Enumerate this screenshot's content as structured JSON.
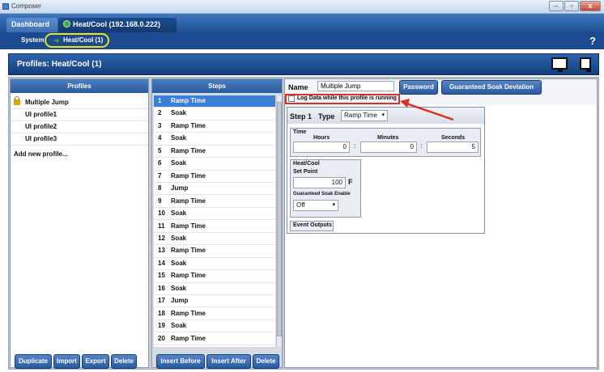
{
  "window": {
    "title": "Composer",
    "minimize": "–",
    "restore": "▫",
    "close": "x"
  },
  "tabs": [
    {
      "label": "Dashboard"
    },
    {
      "label": "Heat/Cool (192.168.0.222)"
    }
  ],
  "breadcrumb": [
    {
      "label": "System"
    },
    {
      "label": "Heat/Cool (1)"
    }
  ],
  "help_label": "?",
  "header": {
    "title": "Profiles: Heat/Cool (1)"
  },
  "profiles": {
    "heading": "Profiles",
    "items": [
      "Multiple Jump",
      "UI profile1",
      "UI profile2",
      "UI profile3"
    ],
    "add_label": "Add new profile...",
    "buttons": [
      "Duplicate",
      "Import",
      "Export",
      "Delete"
    ]
  },
  "steps": {
    "heading": "Steps",
    "items": [
      {
        "num": "1",
        "name": "Ramp Time"
      },
      {
        "num": "2",
        "name": "Soak"
      },
      {
        "num": "3",
        "name": "Ramp Time"
      },
      {
        "num": "4",
        "name": "Soak"
      },
      {
        "num": "5",
        "name": "Ramp Time"
      },
      {
        "num": "6",
        "name": "Soak"
      },
      {
        "num": "7",
        "name": "Ramp Time"
      },
      {
        "num": "8",
        "name": "Jump"
      },
      {
        "num": "9",
        "name": "Ramp Time"
      },
      {
        "num": "10",
        "name": "Soak"
      },
      {
        "num": "11",
        "name": "Ramp Time"
      },
      {
        "num": "12",
        "name": "Soak"
      },
      {
        "num": "13",
        "name": "Ramp Time"
      },
      {
        "num": "14",
        "name": "Soak"
      },
      {
        "num": "15",
        "name": "Ramp Time"
      },
      {
        "num": "16",
        "name": "Soak"
      },
      {
        "num": "17",
        "name": "Jump"
      },
      {
        "num": "18",
        "name": "Ramp Time"
      },
      {
        "num": "19",
        "name": "Soak"
      },
      {
        "num": "20",
        "name": "Ramp Time"
      }
    ],
    "buttons": [
      "Insert Before",
      "Insert After",
      "Delete"
    ]
  },
  "detail": {
    "name_label": "Name",
    "name_value": "Multiple Jump",
    "password_button": "Password",
    "soak_deviation_button": "Guaranteed Soak Deviation",
    "log_data_label": "Log Data while this profile is running",
    "step_label": "Step 1",
    "type_label": "Type",
    "type_value": "Ramp Time",
    "time": {
      "title": "Time",
      "hours_label": "Hours",
      "hours": "0",
      "minutes_label": "Minutes",
      "minutes": "0",
      "seconds_label": "Seconds",
      "seconds": "5"
    },
    "heatcool": {
      "title": "Heat/Cool",
      "setpoint_label": "Set Point",
      "setpoint": "100",
      "unit": "F",
      "soak_enable_label": "Guaranteed Soak Enable",
      "soak_enable_value": "Off"
    },
    "event_outputs": "Event Outputs",
    "time_sep": ":"
  },
  "colors": {
    "accent": "#2b5b9f",
    "selected_row": "#3d7fd6",
    "annotation": "#d93025",
    "crumb_highlight": "#e9e31a"
  }
}
